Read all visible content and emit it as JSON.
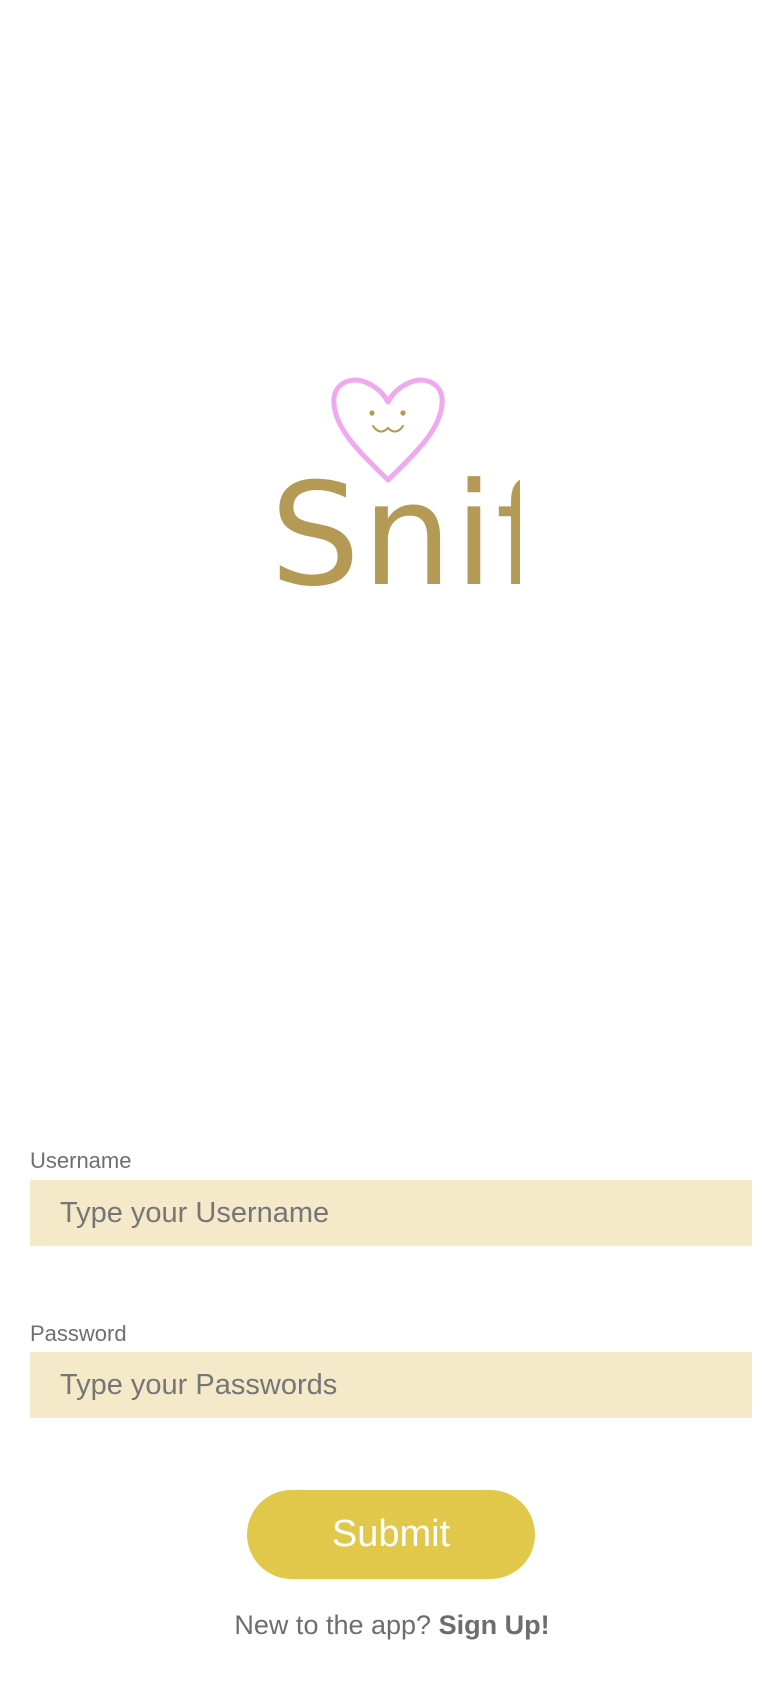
{
  "app": {
    "logo_text": "Snif",
    "logo_icon": "heart-cat-face-icon",
    "colors": {
      "logo_gold": "#b49a55",
      "heart_pink": "#f0a8ef",
      "input_background": "#f4e9c8",
      "submit_background": "#e1c84a"
    }
  },
  "form": {
    "username": {
      "label": "Username",
      "placeholder": "Type your Username",
      "value": ""
    },
    "password": {
      "label": "Password",
      "placeholder": "Type your Passwords",
      "value": ""
    },
    "submit_label": "Submit"
  },
  "footer": {
    "prompt": "New to the app?",
    "signup_label": "Sign Up!"
  }
}
